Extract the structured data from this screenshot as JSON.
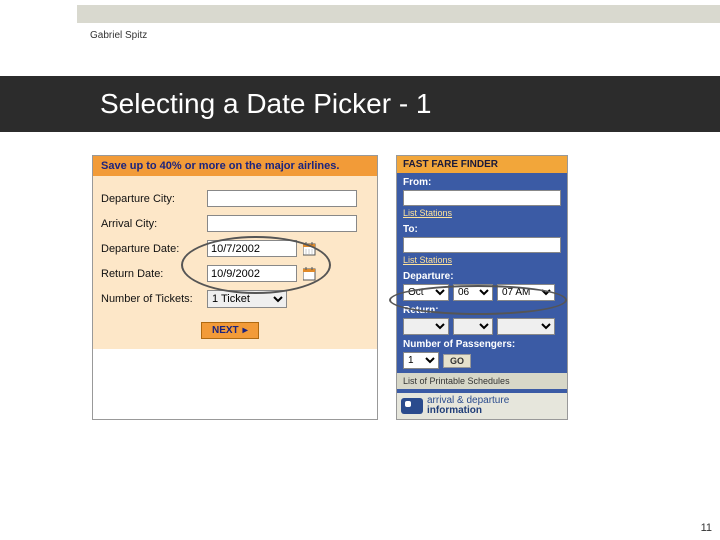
{
  "meta": {
    "author": "Gabriel Spitz",
    "page_number": "11"
  },
  "title": "Selecting a Date Picker - 1",
  "orange_panel": {
    "headline": "Save up to 40% or more on the major airlines.",
    "labels": {
      "dep_city": "Departure City:",
      "arr_city": "Arrival City:",
      "dep_date": "Departure Date:",
      "ret_date": "Return Date:",
      "tickets": "Number of Tickets:"
    },
    "values": {
      "dep_date": "10/7/2002",
      "ret_date": "10/9/2002",
      "tickets": "1 Ticket"
    },
    "next_label": "NEXT"
  },
  "blue_panel": {
    "headline": "FAST FARE FINDER",
    "labels": {
      "from": "From:",
      "to": "To:",
      "departure": "Departure:",
      "return": "Return:",
      "passengers": "Number of Passengers:"
    },
    "links": {
      "list_stations": "List Stations",
      "printable": "List of Printable Schedules"
    },
    "departure": {
      "month": "Oct",
      "day": "06",
      "time": "07 AM"
    },
    "passengers": "1",
    "go_label": "GO",
    "info": {
      "line1": "arrival & departure",
      "line2": "information"
    }
  }
}
